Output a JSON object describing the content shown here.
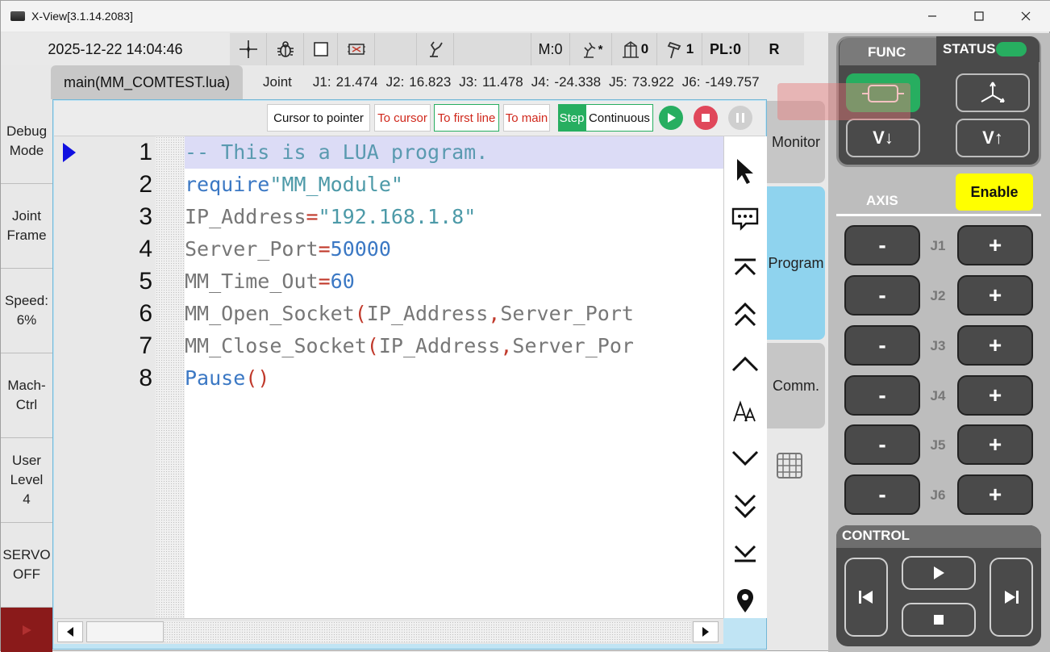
{
  "window": {
    "title": "X-View[3.1.14.2083]",
    "min_icon": "minimize-icon",
    "max_icon": "maximize-icon",
    "close_icon": "close-icon"
  },
  "status": {
    "datetime": "2025-12-22 14:04:46",
    "m_value": "M:0",
    "tool_value": "*",
    "user_frame_value": "0",
    "tool_frame_value": "1",
    "pl_value": "PL:0",
    "mode_value": "R"
  },
  "program": {
    "tab_label": "main(MM_COMTEST.lua)",
    "coord_label": "Joint",
    "joints": [
      {
        "label": "J1:",
        "value": "21.474"
      },
      {
        "label": "J2:",
        "value": "16.823"
      },
      {
        "label": "J3:",
        "value": "11.478"
      },
      {
        "label": "J4:",
        "value": "-24.338"
      },
      {
        "label": "J5:",
        "value": "73.922"
      },
      {
        "label": "J6:",
        "value": "-149.757"
      }
    ]
  },
  "sidebar": {
    "items": [
      {
        "l1": "Debug",
        "l2": "Mode",
        "l3": ""
      },
      {
        "l1": "Joint",
        "l2": "Frame",
        "l3": ""
      },
      {
        "l1": "Speed:",
        "l2": "6%",
        "l3": ""
      },
      {
        "l1": "Mach-",
        "l2": "Ctrl",
        "l3": ""
      },
      {
        "l1": "User",
        "l2": "Level",
        "l3": "4"
      },
      {
        "l1": "SERVO",
        "l2": "OFF",
        "l3": ""
      }
    ]
  },
  "editor": {
    "buttons": {
      "cursor_to_pointer": "Cursor to pointer",
      "to_cursor": "To cursor",
      "to_first_line": "To first line",
      "to_main": "To main",
      "step": "Step",
      "continuous": "Continuous"
    },
    "line_numbers": [
      "1",
      "2",
      "3",
      "4",
      "5",
      "6",
      "7",
      "8"
    ],
    "lines": [
      [
        {
          "t": "-- This is a LUA program.",
          "c": "#5a9ab0"
        }
      ],
      [
        {
          "t": "require",
          "c": "#3b78c4"
        },
        {
          "t": "\"MM_Module\"",
          "c": "#4d9aa8"
        }
      ],
      [
        {
          "t": "IP_Address",
          "c": "#777777"
        },
        {
          "t": "=",
          "c": "#c0392b"
        },
        {
          "t": "\"192.168.1.8\"",
          "c": "#4d9aa8"
        }
      ],
      [
        {
          "t": "Server_Port",
          "c": "#777777"
        },
        {
          "t": "=",
          "c": "#c0392b"
        },
        {
          "t": "50000",
          "c": "#3b78c4"
        }
      ],
      [
        {
          "t": "MM_Time_Out",
          "c": "#777777"
        },
        {
          "t": "=",
          "c": "#c0392b"
        },
        {
          "t": "60",
          "c": "#3b78c4"
        }
      ],
      [
        {
          "t": "MM_Open_Socket",
          "c": "#777777"
        },
        {
          "t": "(",
          "c": "#c0392b"
        },
        {
          "t": "IP_Address",
          "c": "#777777"
        },
        {
          "t": ",",
          "c": "#c0392b"
        },
        {
          "t": "Server_Port",
          "c": "#777777"
        }
      ],
      [
        {
          "t": "MM_Close_Socket",
          "c": "#777777"
        },
        {
          "t": "(",
          "c": "#c0392b"
        },
        {
          "t": "IP_Address",
          "c": "#777777"
        },
        {
          "t": ",",
          "c": "#c0392b"
        },
        {
          "t": "Server_Por",
          "c": "#777777"
        }
      ],
      [
        {
          "t": "Pause",
          "c": "#3b78c4"
        },
        {
          "t": "()",
          "c": "#c0392b"
        }
      ]
    ]
  },
  "side_tabs": {
    "monitor": "Monitor",
    "program": "Program",
    "comm": "Comm."
  },
  "func_panel": {
    "func_label": "FUNC",
    "status_label": "STATUS",
    "v_down": "V↓",
    "v_up": "V↑",
    "axis_label": "AXIS",
    "enable_label": "Enable",
    "axes": [
      "J1",
      "J2",
      "J3",
      "J4",
      "J5",
      "J6"
    ],
    "minus": "-",
    "plus": "+",
    "control_label": "CONTROL"
  },
  "colors": {
    "accent_green": "#27ae60",
    "enable_yellow": "#ffff00",
    "panel_dark": "#4a4a4a",
    "current_line": "#dcdcf6",
    "side_tab_active": "#8fd3ee"
  }
}
